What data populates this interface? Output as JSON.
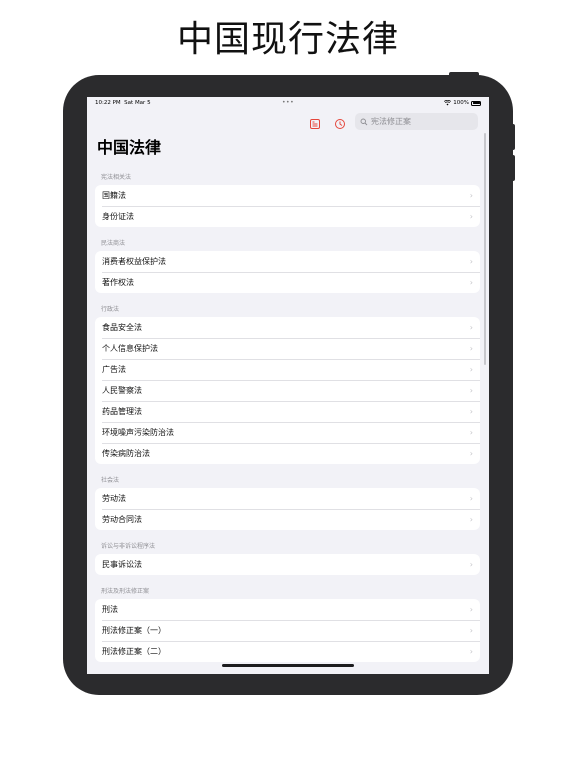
{
  "page_title": "中国现行法律",
  "status_bar": {
    "time": "10:22 PM",
    "date": "Sat Mar 5",
    "dots": "•••",
    "battery": "100%"
  },
  "toolbar": {
    "left_icon": "list-icon",
    "middle_icon": "clock-icon",
    "accent_color": "#e5463b"
  },
  "search": {
    "placeholder": "宪法修正案",
    "icon": "search-icon"
  },
  "nav": {
    "large_title": "中国法律"
  },
  "sections": [
    {
      "header": "宪法相关法",
      "items": [
        "国籍法",
        "身份证法"
      ]
    },
    {
      "header": "民法商法",
      "items": [
        "消费者权益保护法",
        "著作权法"
      ]
    },
    {
      "header": "行政法",
      "items": [
        "食品安全法",
        "个人信息保护法",
        "广告法",
        "人民警察法",
        "药品管理法",
        "环境噪声污染防治法",
        "传染病防治法"
      ]
    },
    {
      "header": "社会法",
      "items": [
        "劳动法",
        "劳动合同法"
      ]
    },
    {
      "header": "诉讼与非诉讼程序法",
      "items": [
        "民事诉讼法"
      ]
    },
    {
      "header": "刑法及刑法修正案",
      "items": [
        "刑法",
        "刑法修正案（一）",
        "刑法修正案（二）"
      ]
    }
  ],
  "chevron": "›"
}
